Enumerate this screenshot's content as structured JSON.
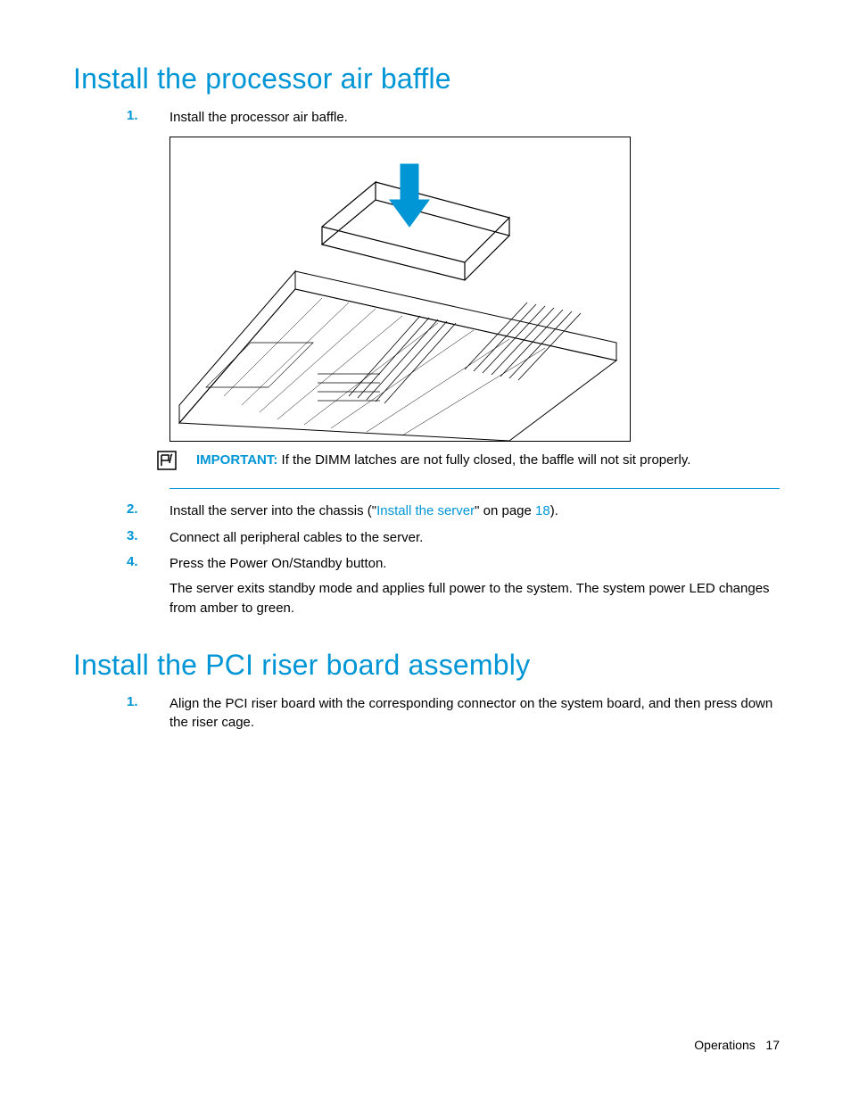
{
  "section1": {
    "heading": "Install the processor air baffle",
    "steps": {
      "s1": {
        "num": "1.",
        "text": "Install the processor air baffle."
      },
      "s2": {
        "num": "2.",
        "pre": "Install the server into the chassis (\"",
        "link": "Install the server",
        "post": "\" on page ",
        "page": "18",
        "end": ")."
      },
      "s3": {
        "num": "3.",
        "text": "Connect all peripheral cables to the server."
      },
      "s4": {
        "num": "4.",
        "text": "Press the Power On/Standby button.",
        "para": "The server exits standby mode and applies full power to the system. The system power LED changes from amber to green."
      }
    },
    "important": {
      "label": "IMPORTANT:",
      "text": "  If the DIMM latches are not fully closed, the baffle will not sit properly."
    }
  },
  "section2": {
    "heading": "Install the PCI riser board assembly",
    "steps": {
      "s1": {
        "num": "1.",
        "text": "Align the PCI riser board with the corresponding connector on the system board, and then press down the riser cage."
      }
    }
  },
  "footer": {
    "section": "Operations",
    "page": "17"
  }
}
